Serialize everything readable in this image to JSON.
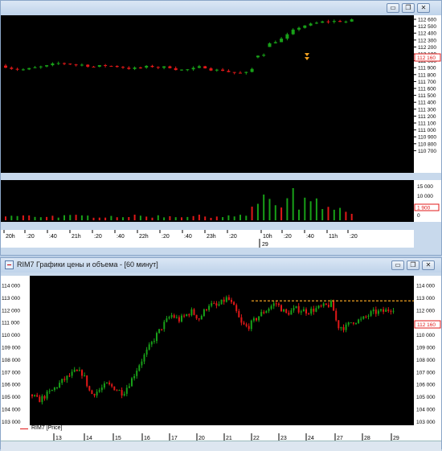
{
  "top_window": {
    "price_axis": [
      "112 600",
      "112 500",
      "112 400",
      "112 300",
      "112 200",
      "112 100",
      "112 000",
      "111 900",
      "111 800",
      "111 700",
      "111 600",
      "111 500",
      "111 400",
      "111 300",
      "111 200",
      "111 100",
      "111 000",
      "110 900",
      "110 800",
      "110 700"
    ],
    "price_badge": "112 160",
    "volume_axis": [
      "15 000",
      "10 000",
      "5 000",
      "0"
    ],
    "volume_badge": "1 900",
    "time_axis": [
      "20h",
      ":20",
      ":40",
      "21h",
      ":20",
      ":40",
      "22h",
      ":20",
      ":40",
      "23h",
      ":20",
      "10h",
      ":20",
      ":40",
      "11h",
      ":20"
    ],
    "date_label": "29"
  },
  "bottom_window": {
    "title": "RIM7 Графики цены и объема - [60 минут]",
    "price_axis": [
      "114 000",
      "113 000",
      "112 000",
      "111 000",
      "110 000",
      "109 000",
      "108 000",
      "107 000",
      "106 000",
      "105 000",
      "104 000",
      "103 000"
    ],
    "price_badge": "112 160",
    "legend": "RIM7 [Price]",
    "date_axis": [
      "13",
      "14",
      "15",
      "16",
      "17",
      "20",
      "21",
      "22",
      "23",
      "24",
      "27",
      "28",
      "29"
    ]
  },
  "colors": {
    "up": "#18a018",
    "down": "#e01818",
    "level": "#f0a020",
    "axis_text": "#000000"
  }
}
